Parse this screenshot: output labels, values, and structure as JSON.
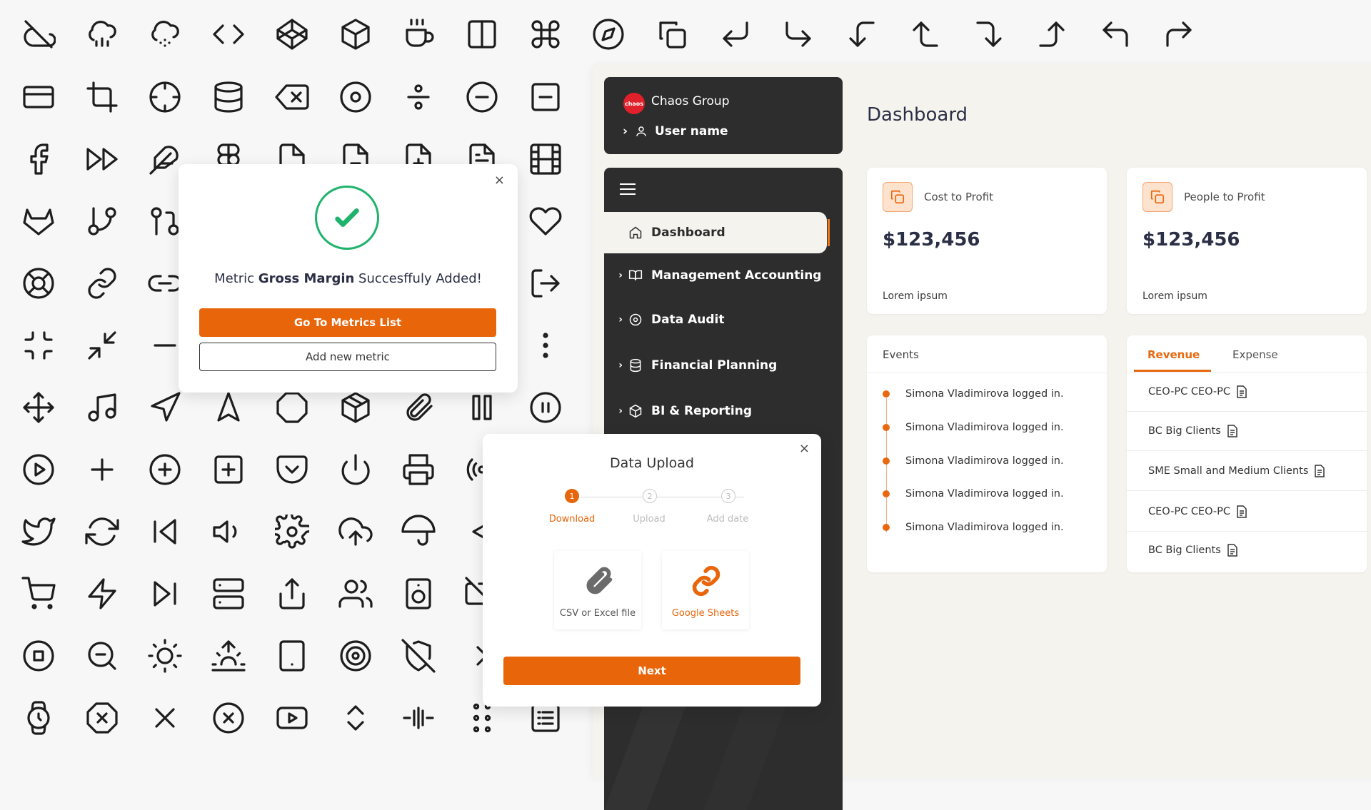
{
  "icon_sheet": {
    "icons": [
      "cloud-off-icon",
      "cloud-drizzle-icon",
      "cloud-snow-icon",
      "code-icon",
      "codepen-icon",
      "codesandbox-icon",
      "coffee-icon",
      "columns-icon",
      "command-icon",
      "compass-icon",
      "copy-icon",
      "corner-down-left-icon",
      "corner-down-right-icon",
      "corner-left-down-icon",
      "corner-left-up-icon",
      "corner-right-down-icon",
      "corner-right-up-icon",
      "corner-up-left-icon",
      "corner-up-right-icon",
      "credit-card-icon",
      "crop-icon",
      "crosshair-icon",
      "database-icon",
      "delete-icon",
      "disc-icon",
      "divide-icon",
      "minus-circle-icon",
      "minus-square-icon",
      "facebook-icon",
      "fast-forward-icon",
      "feather-icon",
      "figma-icon",
      "file-icon",
      "file-minus-icon",
      "file-plus-icon",
      "file-text-icon",
      "film-icon",
      "gitlab-icon",
      "git-branch-icon",
      "git-pull-request-icon",
      "heart-icon",
      "life-buoy-icon",
      "link-icon",
      "link-2-icon",
      "log-out-icon",
      "minimize-icon",
      "minimize-2-icon",
      "minus-icon",
      "more-vertical-icon",
      "move-icon",
      "music-icon",
      "navigation-icon",
      "navigation-2-icon",
      "octagon-icon",
      "package-icon",
      "paperclip-icon",
      "pause-icon",
      "pause-circle-icon",
      "play-circle-icon",
      "plus-icon",
      "plus-circle-icon",
      "plus-square-icon",
      "pocket-icon",
      "power-icon",
      "printer-icon",
      "radio-icon",
      "twitter-icon",
      "refresh-icon",
      "skip-back-icon",
      "volume-icon",
      "settings-icon",
      "upload-cloud-icon",
      "umbrella-icon",
      "triangle-left-icon",
      "shopping-cart-icon",
      "zap-icon",
      "skip-forward-icon",
      "server-icon",
      "share-icon",
      "users-icon",
      "speaker-icon",
      "video-off-icon",
      "stop-circle-icon",
      "zoom-out-icon",
      "sun-icon",
      "sunrise-icon",
      "tablet-icon",
      "target-icon",
      "shield-off-icon",
      "chevron-right-icon",
      "watch-icon",
      "x-octagon-icon",
      "x-icon",
      "x-circle-icon",
      "youtube-icon",
      "chevrons-up-down-icon",
      "columns-split-icon",
      "grid-dots-icon",
      "list-icon"
    ]
  },
  "brand": {
    "logo_text": "chaos",
    "org_name": "Chaos Group",
    "user_name": "User name"
  },
  "sidebar": {
    "items": [
      {
        "label": "Dashboard",
        "icon": "home-icon",
        "active": true
      },
      {
        "label": "Management Accounting",
        "icon": "book-open-icon"
      },
      {
        "label": "Data Audit",
        "icon": "disc-icon"
      },
      {
        "label": "Financial Planning",
        "icon": "database-icon"
      },
      {
        "label": "BI & Reporting",
        "icon": "package-icon"
      }
    ]
  },
  "page": {
    "title": "Dashboard"
  },
  "metrics": [
    {
      "label": "Cost to Profit",
      "value": "$123,456",
      "sub": "Lorem ipsum",
      "icon": "copy-icon"
    },
    {
      "label": "People to Profit",
      "value": "$123,456",
      "sub": "Lorem ipsum",
      "icon": "copy-icon"
    }
  ],
  "events": {
    "title": "Events",
    "items": [
      "Simona Vladimirova logged in.",
      "Simona Vladimirova logged in.",
      "Simona Vladimirova logged in.",
      "Simona Vladimirova logged in.",
      "Simona Vladimirova logged in."
    ]
  },
  "revenue": {
    "tabs": [
      "Revenue",
      "Expense"
    ],
    "rows": [
      "CEO-PC CEO-PC",
      "BC Big Clients",
      "SME Small and Medium Clients",
      "CEO-PC CEO-PC",
      "BC Big Clients"
    ]
  },
  "success_modal": {
    "close": "×",
    "msg_prefix": "Metric ",
    "metric_name": "Gross Margin",
    "msg_suffix": " Succesffuly Added!",
    "primary": "Go To Metrics List",
    "secondary": "Add new metric"
  },
  "upload_modal": {
    "title": "Data Upload",
    "close": "×",
    "steps": [
      {
        "num": "1",
        "label": "Download"
      },
      {
        "num": "2",
        "label": "Upload"
      },
      {
        "num": "3",
        "label": "Add date"
      }
    ],
    "sources": [
      {
        "label": "CSV or Excel file",
        "icon": "paperclip-icon"
      },
      {
        "label": "Google Sheets",
        "icon": "link-icon"
      }
    ],
    "next": "Next"
  },
  "colors": {
    "accent": "#e8650a",
    "sidebar": "#2d2d2d",
    "success": "#1fb36b",
    "background": "#f5f3ee"
  }
}
